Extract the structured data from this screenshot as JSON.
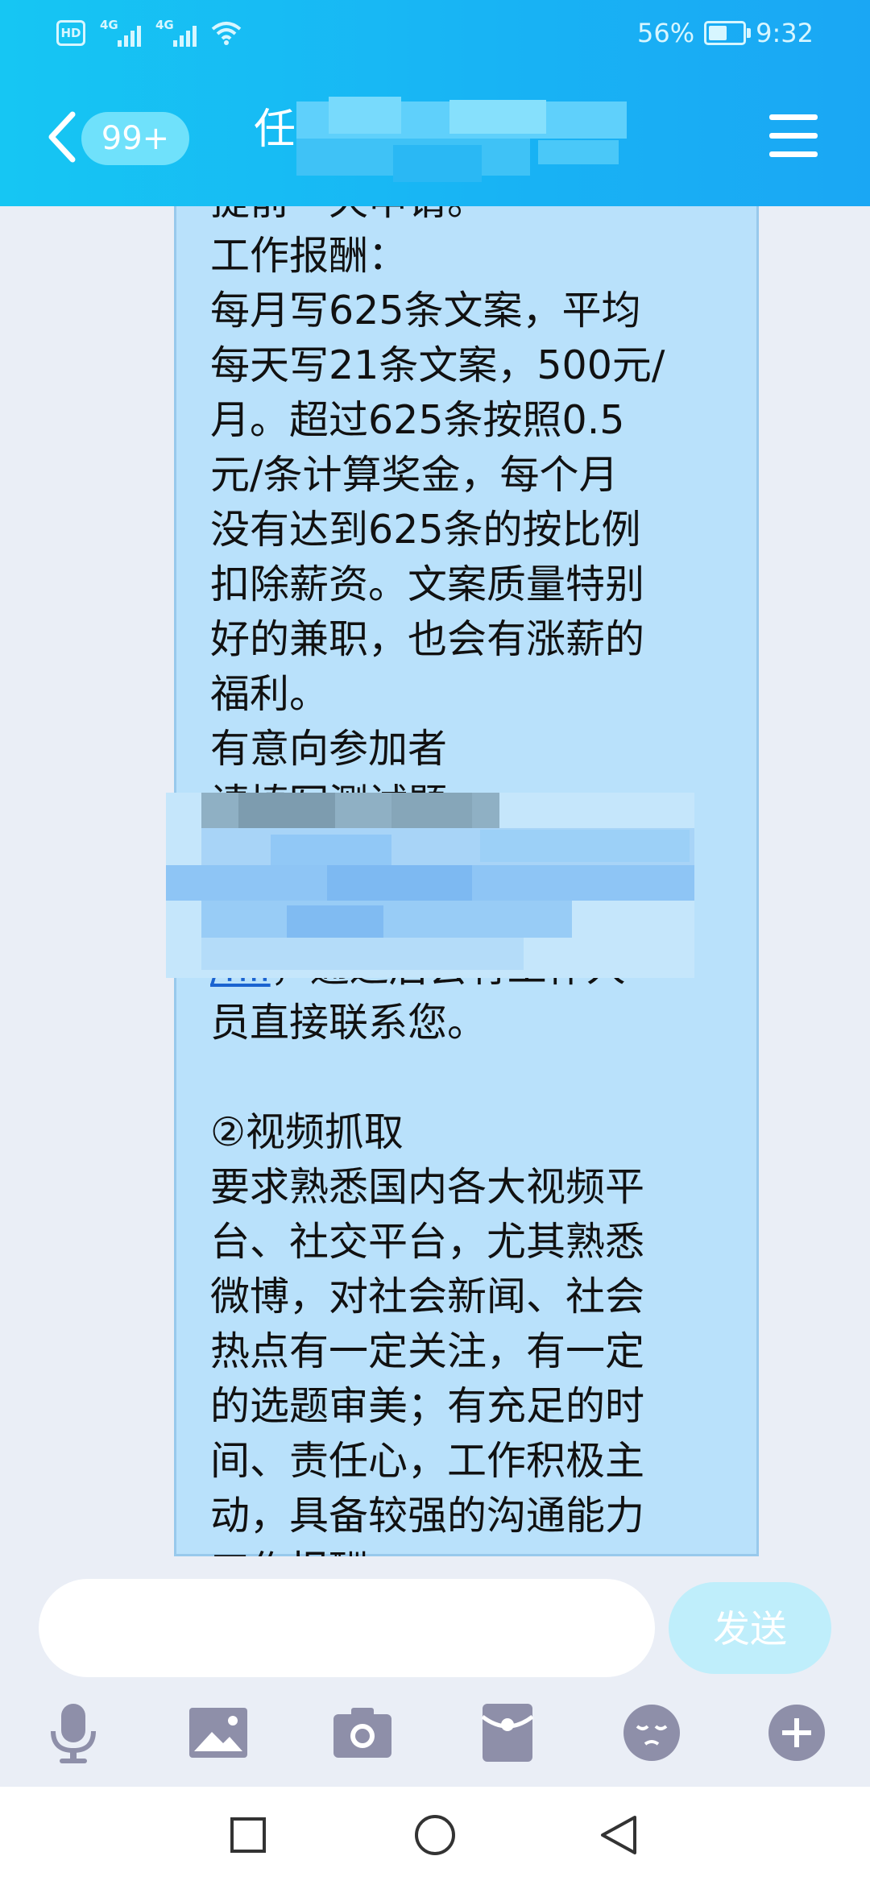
{
  "status_bar": {
    "hd_label": "HD",
    "network_1": "4G",
    "network_2": "4G",
    "battery_text": "56%",
    "battery_level": 0.56,
    "time": "9:32"
  },
  "header": {
    "unread_badge": "99+",
    "title": "任"
  },
  "message": {
    "lines": [
      "提前一天申请。",
      "工作报酬：",
      "每月写625条文案，平均",
      "每天写21条文案，500元/",
      "月。超过625条按照0.5",
      "元/条计算奖金，每个月",
      "没有达到625条的按比例",
      "扣除薪资。文案质量特别",
      "好的兼职，也会有涨薪的",
      "福利。",
      "有意向参加者",
      "请填写测试题"
    ],
    "link_tail": "/fill",
    "after_link": "，通过后会有工作人",
    "lines_after": [
      "员直接联系您。",
      "",
      "②视频抓取",
      "要求熟悉国内各大视频平",
      "台、社交平台，尤其熟悉",
      "微博，对社会新闻、社会",
      "热点有一定关注，有一定",
      "的选题审美；有充足的时",
      "间、责任心，工作积极主",
      "动，具备较强的沟通能力",
      "工作报酬："
    ]
  },
  "composer": {
    "input_value": "",
    "send_label": "发送"
  },
  "toolbar_icons": [
    "microphone-icon",
    "image-icon",
    "camera-icon",
    "red-packet-icon",
    "emoji-icon",
    "plus-icon"
  ],
  "nav_icons": [
    "recent-apps-icon",
    "home-icon",
    "back-icon"
  ],
  "colors": {
    "header_blue": "#18b4f4",
    "bubble": "#b9e1fb",
    "link": "#1a63d0",
    "send_button": "#bfeefb"
  }
}
